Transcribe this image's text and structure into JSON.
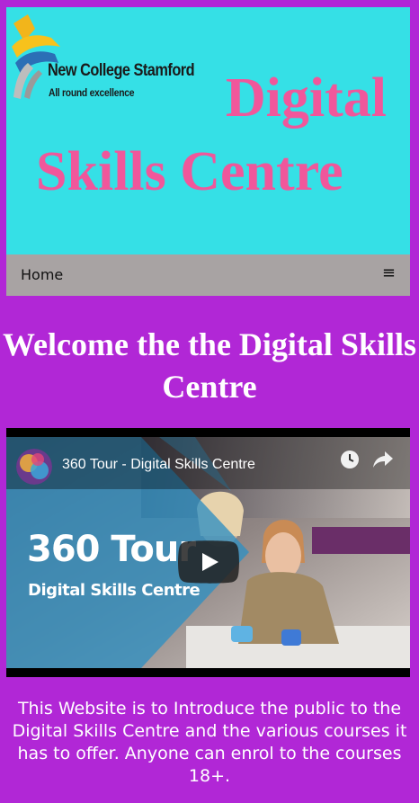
{
  "header": {
    "college_name": "New College Stamford",
    "college_tagline": "All round excellence",
    "brand_line1": "Digital",
    "brand_line2": "Skills Centre"
  },
  "nav": {
    "home_label": "Home",
    "menu_icon": "hamburger-icon"
  },
  "main": {
    "heading": "Welcome the the Digital Skills Centre",
    "video": {
      "title": "360 Tour - Digital Skills Centre",
      "thumbnail_heading": "360 Tour",
      "thumbnail_subheading": "Digital Skills Centre",
      "icons": [
        "channel-avatar-icon",
        "watch-later-icon",
        "share-icon",
        "play-icon"
      ]
    },
    "description": "This Website is to Introduce the public to the Digital Skills Centre and the various courses it has to offer. Anyone can enrol to the courses 18+."
  },
  "colors": {
    "page_background": "#b127d6",
    "header_background": "#35e0e6",
    "brand_pink": "#f0579b",
    "nav_background": "#a8a3a3",
    "youtube_red": "#212121"
  }
}
